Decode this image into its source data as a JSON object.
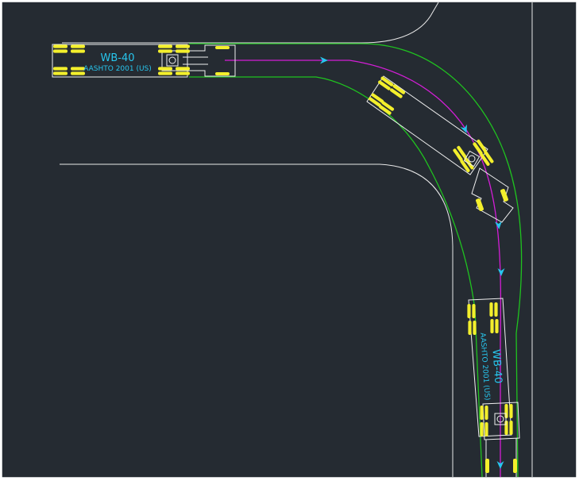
{
  "colors": {
    "background": "#252b32",
    "outer_border": "#ffffff",
    "road_edge": "#e8e8e8",
    "swept_path": "#1fc31f",
    "trajectory": "#d31ed6",
    "direction_arrow": "#27c6ee",
    "vehicle_outline": "#f0f0f0",
    "wheel": "#f3ef2c",
    "vehicle_label": "#27c6ee"
  },
  "icons": {
    "direction_marker": "arrowhead-icon",
    "pivot_marker": "kingpin-circle-icon"
  },
  "vehicle_start": {
    "name_label": "WB-40",
    "standard_label": "AASHTO 2001 (US)"
  },
  "vehicle_end": {
    "name_label": "WB-40",
    "standard_label": "AASHTO 2001 (US)"
  }
}
